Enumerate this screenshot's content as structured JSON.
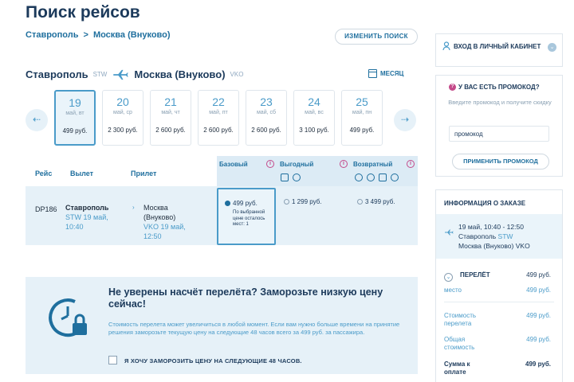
{
  "page_title": "Поиск рейсов",
  "breadcrumb": {
    "from": "Ставрополь",
    "sep": ">",
    "to": "Москва (Внуково)"
  },
  "change_search_label": "ИЗМЕНИТЬ ПОИСК",
  "route": {
    "from": "Ставрополь",
    "from_code": "STW",
    "to": "Москва (Внуково)",
    "to_code": "VKO"
  },
  "month_label": "МЕСЯЦ",
  "dates": [
    {
      "day": "19",
      "weekday": "май, вт",
      "price": "499 руб."
    },
    {
      "day": "20",
      "weekday": "май, ср",
      "price": "2 300 руб."
    },
    {
      "day": "21",
      "weekday": "май, чт",
      "price": "2 600 руб."
    },
    {
      "day": "22",
      "weekday": "май, пт",
      "price": "2 600 руб."
    },
    {
      "day": "23",
      "weekday": "май, сб",
      "price": "2 600 руб."
    },
    {
      "day": "24",
      "weekday": "май, вс",
      "price": "3 100 руб."
    },
    {
      "day": "25",
      "weekday": "май, пн",
      "price": "499 руб."
    }
  ],
  "table": {
    "col_flight": "Рейс",
    "col_departure": "Вылет",
    "col_arrival": "Прилет",
    "fare_basic": "Базовый",
    "fare_profit": "Выгодный",
    "fare_return": "Возвратный"
  },
  "flight": {
    "number": "DP186",
    "dep_city": "Ставрополь",
    "dep_detail": "STW 19 май,",
    "dep_time": "10:40",
    "arr_city_1": "Москва",
    "arr_city_2": "(Внуково)",
    "arr_detail": "VKO 19 май,",
    "arr_time": "12:50",
    "basic_price": "499 руб.",
    "basic_note": "По выбранной цене осталось мест: 1",
    "profit_price": "1 299 руб.",
    "return_price": "3 499 руб."
  },
  "freeze": {
    "title": "Не уверены насчёт перелёта? Заморозьте низкую цену сейчас!",
    "text": "Стоимость перелета может увеличиться в любой момент. Если вам нужно больше времени на принятие решения заморозьте текущую цену на следующие 48 часов всего за 499 руб. за пассажира.",
    "checkbox_label": "Я ХОЧУ ЗАМОРОЗИТЬ ЦЕНУ НА СЛЕДУЮЩИЕ 48 ЧАСОВ."
  },
  "sidebar": {
    "login_label": "ВХОД В ЛИЧНЫЙ КАБИНЕТ",
    "promo_title": "У ВАС ЕСТЬ ПРОМОКОД?",
    "promo_hint": "Введите промокод и получите скидку",
    "promo_value": "промокод",
    "promo_button": "ПРИМЕНИТЬ ПРОМОКОД",
    "order_title": "ИНФОРМАЦИЯ О ЗАКАЗЕ",
    "order_time": "19 май, 10:40 - 12:50",
    "order_from": "Ставрополь",
    "order_from_code": "STW",
    "order_to": "Москва (Внуково)",
    "order_to_code": "VKO",
    "flight_label": "ПЕРЕЛЁТ",
    "flight_price": "499 руб.",
    "seat_label": "место",
    "seat_price": "499 руб.",
    "cost_label": "Стоимость перелета",
    "cost_value": "499 руб.",
    "total_cost_label": "Общая стоимость",
    "total_cost_value": "499 руб.",
    "pay_label": "Сумма к оплате",
    "pay_value": "499 руб."
  },
  "colors": {
    "accent": "#4a9bc9",
    "dark": "#1c3a5b",
    "panel": "#e6f1f8",
    "info": "#c44a8a"
  }
}
